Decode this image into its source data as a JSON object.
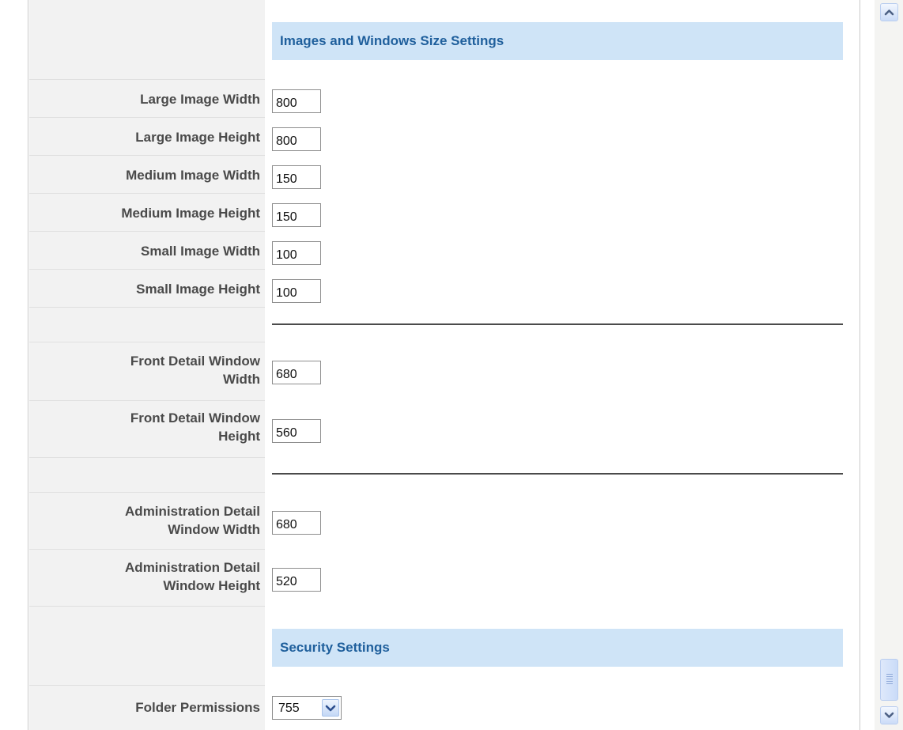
{
  "sections": {
    "images": {
      "header": "Images and Windows Size Settings",
      "fields": [
        {
          "label": "Large Image Width",
          "value": "800"
        },
        {
          "label": "Large Image Height",
          "value": "800"
        },
        {
          "label": "Medium Image Width",
          "value": "150"
        },
        {
          "label": "Medium Image Height",
          "value": "150"
        },
        {
          "label": "Small Image Width",
          "value": "100"
        },
        {
          "label": "Small Image Height",
          "value": "100"
        }
      ]
    },
    "front_window": {
      "fields": [
        {
          "label_line1": "Front Detail Window",
          "label_line2": "Width",
          "value": "680"
        },
        {
          "label_line1": "Front Detail Window",
          "label_line2": "Height",
          "value": "560"
        }
      ]
    },
    "admin_window": {
      "fields": [
        {
          "label_line1": "Administration Detail",
          "label_line2": "Window Width",
          "value": "680"
        },
        {
          "label_line1": "Administration Detail",
          "label_line2": "Window Height",
          "value": "520"
        }
      ]
    },
    "security": {
      "header": "Security Settings",
      "folder_permissions": {
        "label": "Folder Permissions",
        "value": "755"
      }
    }
  },
  "scrollbar": {
    "up_icon": "chevron-up-icon",
    "down_icon": "chevron-down-icon"
  },
  "colors": {
    "section_header_bg": "#cfe4f7",
    "section_header_text": "#1f5f9c",
    "label_column_bg": "#f2f2f2",
    "label_text": "#4a4a4a"
  }
}
